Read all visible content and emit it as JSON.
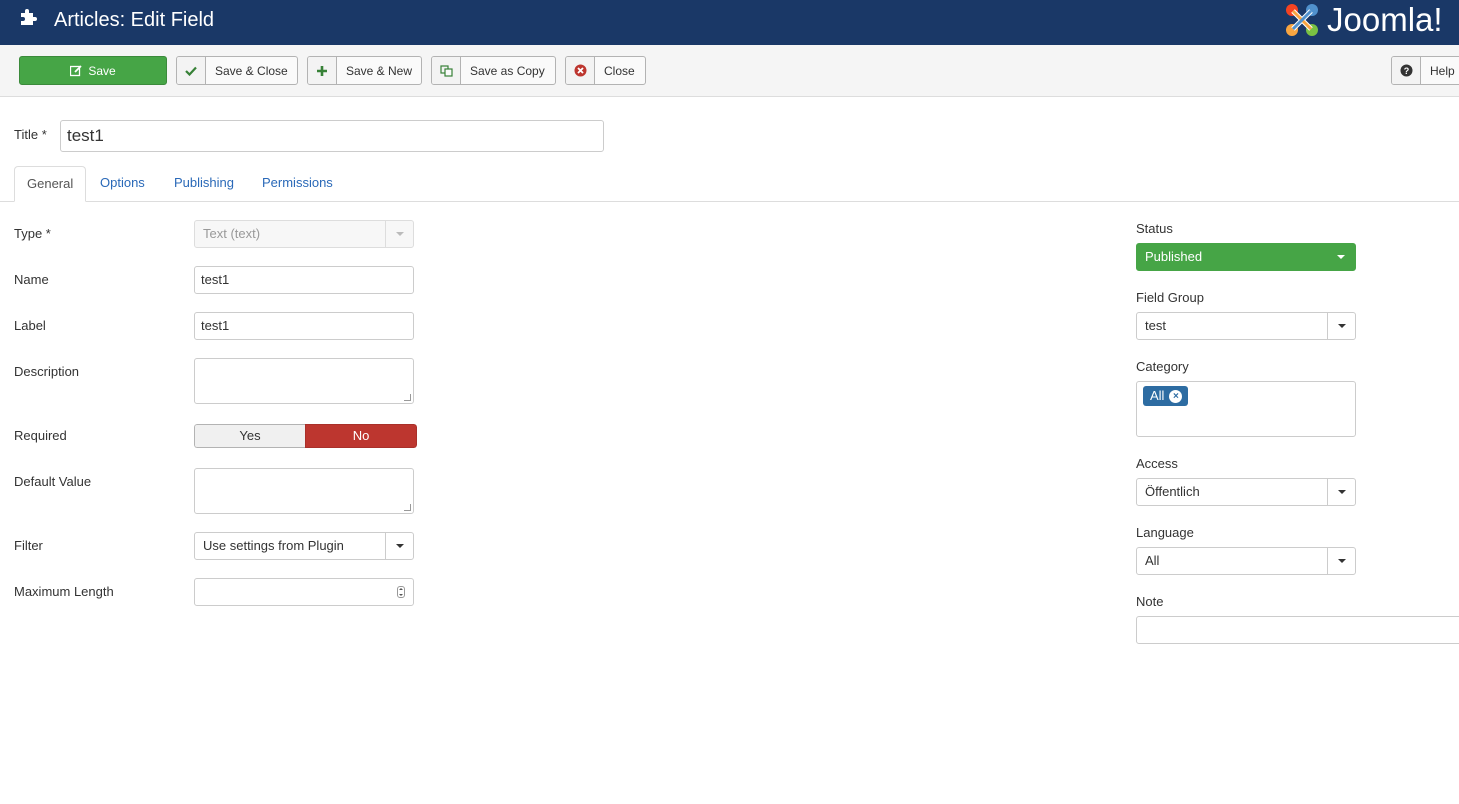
{
  "header": {
    "title": "Articles: Edit Field",
    "brand": "Joomla!"
  },
  "toolbar": {
    "save": "Save",
    "save_close": "Save & Close",
    "save_new": "Save & New",
    "save_copy": "Save as Copy",
    "close": "Close",
    "help": "Help"
  },
  "title_field": {
    "label": "Title *",
    "value": "test1"
  },
  "tabs": [
    "General",
    "Options",
    "Publishing",
    "Permissions"
  ],
  "general": {
    "type": {
      "label": "Type *",
      "value": "Text (text)"
    },
    "name": {
      "label": "Name",
      "value": "test1"
    },
    "label_field": {
      "label": "Label",
      "value": "test1"
    },
    "description": {
      "label": "Description",
      "value": ""
    },
    "required": {
      "label": "Required",
      "yes": "Yes",
      "no": "No",
      "selected": "No"
    },
    "default_value": {
      "label": "Default Value",
      "value": ""
    },
    "filter": {
      "label": "Filter",
      "value": "Use settings from Plugin"
    },
    "max_length": {
      "label": "Maximum Length",
      "value": ""
    }
  },
  "sidebar": {
    "status": {
      "label": "Status",
      "value": "Published"
    },
    "field_group": {
      "label": "Field Group",
      "value": "test"
    },
    "category": {
      "label": "Category",
      "chips": [
        "All"
      ]
    },
    "access": {
      "label": "Access",
      "value": "Öffentlich"
    },
    "language": {
      "label": "Language",
      "value": "All"
    },
    "note": {
      "label": "Note",
      "value": ""
    }
  },
  "colors": {
    "header": "#1a3867",
    "save": "#46a546",
    "no_active": "#bd362f",
    "link": "#2a69b8",
    "chip": "#2d6ca2"
  }
}
